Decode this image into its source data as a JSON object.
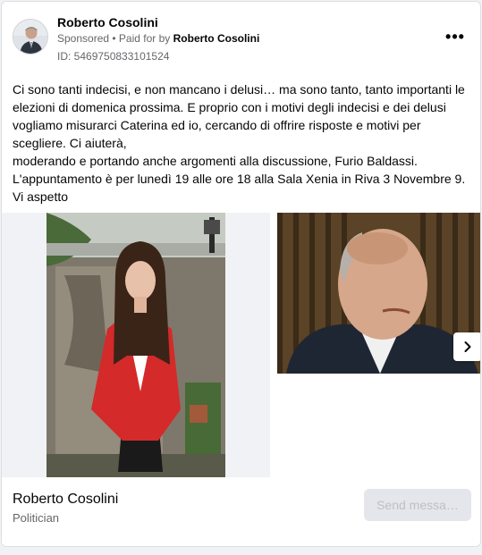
{
  "ad": {
    "page_name": "Roberto Cosolini",
    "sponsored_label": "Sponsored",
    "separator": " • ",
    "paid_for_label": "Paid for by ",
    "paid_for_name": "Roberto Cosolini",
    "ad_id": "ID: 5469750833101524",
    "more_label": "•••"
  },
  "body": {
    "paragraphs": [
      "Ci sono tanti indecisi, e non mancano i delusi… ma sono tanto, tanto importanti le elezioni di domenica prossima. E proprio con i motivi degli indecisi e dei delusi vogliamo misurarci Caterina ed io, cercando di offrire risposte e motivi per scegliere. Ci aiuterà,",
      "moderando e portando anche argomenti alla discussione, Furio Baldassi.",
      "L'appuntamento è per lunedì 19 alle ore 18 alla Sala Xenia in Riva 3 Novembre 9. Vi aspetto"
    ]
  },
  "footer": {
    "page_name": "Roberto Cosolini",
    "category": "Politician",
    "cta_label": "Send messa…"
  },
  "icons": {
    "next": "chevron-right-icon",
    "more": "more-horizontal-icon"
  },
  "colors": {
    "text_primary": "#050505",
    "text_secondary": "#65676b",
    "cta_bg": "#e4e6eb",
    "cta_text": "#bcc0c4",
    "jacket_red": "#d42a2a"
  }
}
